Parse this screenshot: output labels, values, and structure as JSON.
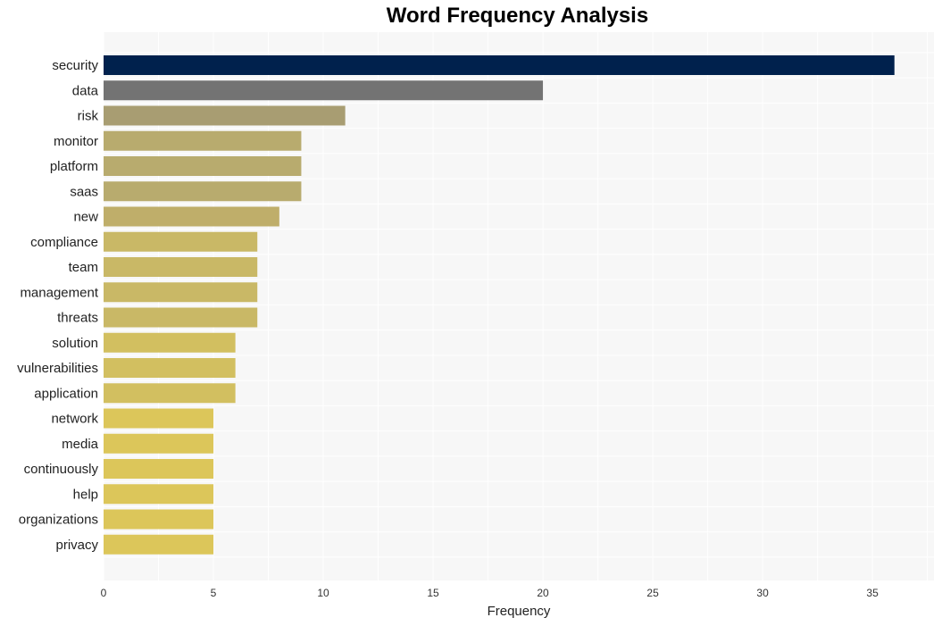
{
  "chart_data": {
    "type": "bar",
    "orientation": "horizontal",
    "title": "Word Frequency Analysis",
    "xlabel": "Frequency",
    "ylabel": "",
    "xlim": [
      0,
      37.8
    ],
    "xticks": [
      0,
      5,
      10,
      15,
      20,
      25,
      30,
      35
    ],
    "grid": true,
    "categories": [
      "security",
      "data",
      "risk",
      "monitor",
      "platform",
      "saas",
      "new",
      "compliance",
      "team",
      "management",
      "threats",
      "solution",
      "vulnerabilities",
      "application",
      "network",
      "media",
      "continuously",
      "help",
      "organizations",
      "privacy"
    ],
    "values": [
      36,
      20,
      11,
      9,
      9,
      9,
      8,
      7,
      7,
      7,
      7,
      6,
      6,
      6,
      5,
      5,
      5,
      5,
      5,
      5
    ],
    "colors": [
      "#00214d",
      "#737373",
      "#a89d72",
      "#b8ab6e",
      "#b8ab6e",
      "#b8ab6e",
      "#bfae6a",
      "#c9b866",
      "#c9b866",
      "#c9b866",
      "#c9b866",
      "#d2bf60",
      "#d2bf60",
      "#d2bf60",
      "#dcc65a",
      "#dcc65a",
      "#dcc65a",
      "#dcc65a",
      "#dcc65a",
      "#dcc65a"
    ],
    "background": "#f7f7f7"
  }
}
